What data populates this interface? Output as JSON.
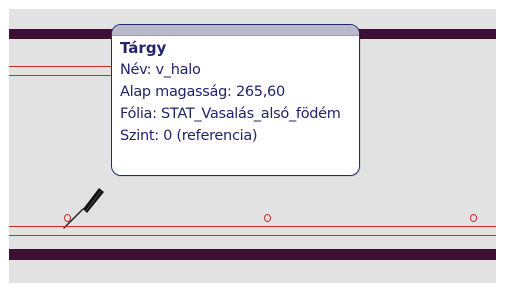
{
  "tooltip": {
    "title": "Tárgy",
    "name": "Név: v_halo",
    "base_height": "Alap magasság: 265,60",
    "layer": "Fólia: STAT_Vasalás_alsó_födém",
    "level": "Szint: 0 (referencia)"
  },
  "icons": {
    "cursor": "pen-icon",
    "markers": "node-marker-icon"
  },
  "colors": {
    "canvas_background": "#e2e2e2",
    "wall_band": "#3d0f32",
    "rebar_line": "#ce2b2b",
    "tooltip_border": "#1f2c6e",
    "tooltip_text": "#23236e",
    "tooltip_header": "#b9b9ca"
  }
}
